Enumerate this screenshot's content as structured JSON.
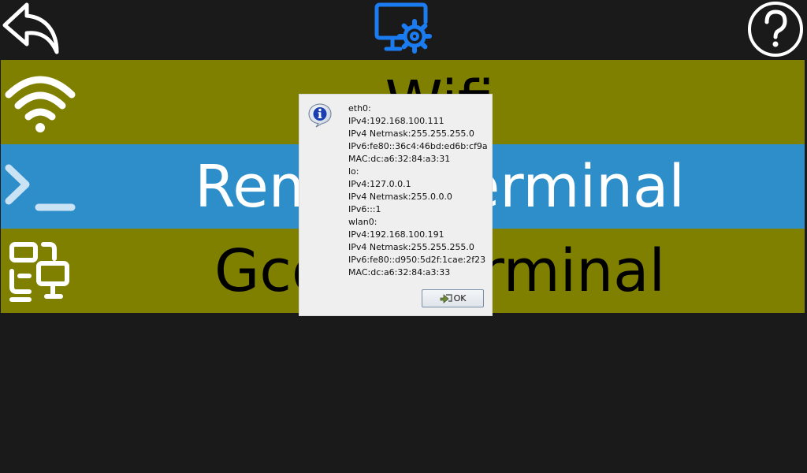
{
  "header": {
    "back_icon": "back-arrow-icon",
    "center_icon": "monitor-settings-icon",
    "help_icon": "help-circle-icon",
    "accent_color": "#1a7cf0"
  },
  "menu": {
    "items": [
      {
        "label": "Wifi",
        "icon": "wifi-icon",
        "background": "#808000",
        "text_color": "#000000"
      },
      {
        "label": "Remote Terminal",
        "icon": "terminal-prompt-icon",
        "background": "#2e8ec9",
        "text_color": "#ffffff"
      },
      {
        "label": "Gcode Terminal",
        "icon": "devices-icon",
        "background": "#808000",
        "text_color": "#000000"
      }
    ]
  },
  "dialog": {
    "icon": "info-icon",
    "lines": [
      "eth0:",
      "IPv4:192.168.100.111",
      "IPv4 Netmask:255.255.255.0",
      "IPv6:fe80::36c4:46bd:ed6b:cf9a",
      "MAC:dc:a6:32:84:a3:31",
      "lo:",
      "IPv4:127.0.0.1",
      "IPv4 Netmask:255.0.0.0",
      "IPv6:::1",
      "wlan0:",
      "IPv4:192.168.100.191",
      "IPv4 Netmask:255.255.255.0",
      "IPv6:fe80::d950:5d2f:1cae:2f23",
      "MAC:dc:a6:32:84:a3:33"
    ],
    "ok_label": "OK",
    "ok_icon": "check-arrow-icon"
  }
}
